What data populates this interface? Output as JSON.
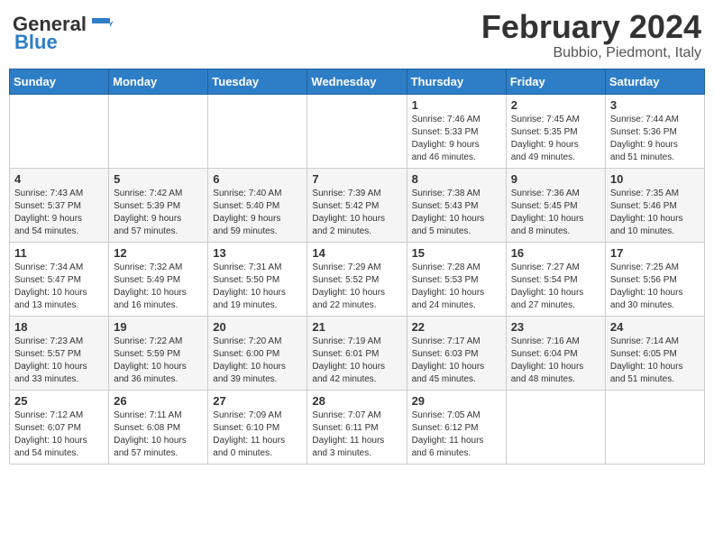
{
  "logo": {
    "general": "General",
    "blue": "Blue"
  },
  "title": "February 2024",
  "location": "Bubbio, Piedmont, Italy",
  "days_header": [
    "Sunday",
    "Monday",
    "Tuesday",
    "Wednesday",
    "Thursday",
    "Friday",
    "Saturday"
  ],
  "weeks": [
    [
      {
        "day": "",
        "info": ""
      },
      {
        "day": "",
        "info": ""
      },
      {
        "day": "",
        "info": ""
      },
      {
        "day": "",
        "info": ""
      },
      {
        "day": "1",
        "info": "Sunrise: 7:46 AM\nSunset: 5:33 PM\nDaylight: 9 hours\nand 46 minutes."
      },
      {
        "day": "2",
        "info": "Sunrise: 7:45 AM\nSunset: 5:35 PM\nDaylight: 9 hours\nand 49 minutes."
      },
      {
        "day": "3",
        "info": "Sunrise: 7:44 AM\nSunset: 5:36 PM\nDaylight: 9 hours\nand 51 minutes."
      }
    ],
    [
      {
        "day": "4",
        "info": "Sunrise: 7:43 AM\nSunset: 5:37 PM\nDaylight: 9 hours\nand 54 minutes."
      },
      {
        "day": "5",
        "info": "Sunrise: 7:42 AM\nSunset: 5:39 PM\nDaylight: 9 hours\nand 57 minutes."
      },
      {
        "day": "6",
        "info": "Sunrise: 7:40 AM\nSunset: 5:40 PM\nDaylight: 9 hours\nand 59 minutes."
      },
      {
        "day": "7",
        "info": "Sunrise: 7:39 AM\nSunset: 5:42 PM\nDaylight: 10 hours\nand 2 minutes."
      },
      {
        "day": "8",
        "info": "Sunrise: 7:38 AM\nSunset: 5:43 PM\nDaylight: 10 hours\nand 5 minutes."
      },
      {
        "day": "9",
        "info": "Sunrise: 7:36 AM\nSunset: 5:45 PM\nDaylight: 10 hours\nand 8 minutes."
      },
      {
        "day": "10",
        "info": "Sunrise: 7:35 AM\nSunset: 5:46 PM\nDaylight: 10 hours\nand 10 minutes."
      }
    ],
    [
      {
        "day": "11",
        "info": "Sunrise: 7:34 AM\nSunset: 5:47 PM\nDaylight: 10 hours\nand 13 minutes."
      },
      {
        "day": "12",
        "info": "Sunrise: 7:32 AM\nSunset: 5:49 PM\nDaylight: 10 hours\nand 16 minutes."
      },
      {
        "day": "13",
        "info": "Sunrise: 7:31 AM\nSunset: 5:50 PM\nDaylight: 10 hours\nand 19 minutes."
      },
      {
        "day": "14",
        "info": "Sunrise: 7:29 AM\nSunset: 5:52 PM\nDaylight: 10 hours\nand 22 minutes."
      },
      {
        "day": "15",
        "info": "Sunrise: 7:28 AM\nSunset: 5:53 PM\nDaylight: 10 hours\nand 24 minutes."
      },
      {
        "day": "16",
        "info": "Sunrise: 7:27 AM\nSunset: 5:54 PM\nDaylight: 10 hours\nand 27 minutes."
      },
      {
        "day": "17",
        "info": "Sunrise: 7:25 AM\nSunset: 5:56 PM\nDaylight: 10 hours\nand 30 minutes."
      }
    ],
    [
      {
        "day": "18",
        "info": "Sunrise: 7:23 AM\nSunset: 5:57 PM\nDaylight: 10 hours\nand 33 minutes."
      },
      {
        "day": "19",
        "info": "Sunrise: 7:22 AM\nSunset: 5:59 PM\nDaylight: 10 hours\nand 36 minutes."
      },
      {
        "day": "20",
        "info": "Sunrise: 7:20 AM\nSunset: 6:00 PM\nDaylight: 10 hours\nand 39 minutes."
      },
      {
        "day": "21",
        "info": "Sunrise: 7:19 AM\nSunset: 6:01 PM\nDaylight: 10 hours\nand 42 minutes."
      },
      {
        "day": "22",
        "info": "Sunrise: 7:17 AM\nSunset: 6:03 PM\nDaylight: 10 hours\nand 45 minutes."
      },
      {
        "day": "23",
        "info": "Sunrise: 7:16 AM\nSunset: 6:04 PM\nDaylight: 10 hours\nand 48 minutes."
      },
      {
        "day": "24",
        "info": "Sunrise: 7:14 AM\nSunset: 6:05 PM\nDaylight: 10 hours\nand 51 minutes."
      }
    ],
    [
      {
        "day": "25",
        "info": "Sunrise: 7:12 AM\nSunset: 6:07 PM\nDaylight: 10 hours\nand 54 minutes."
      },
      {
        "day": "26",
        "info": "Sunrise: 7:11 AM\nSunset: 6:08 PM\nDaylight: 10 hours\nand 57 minutes."
      },
      {
        "day": "27",
        "info": "Sunrise: 7:09 AM\nSunset: 6:10 PM\nDaylight: 11 hours\nand 0 minutes."
      },
      {
        "day": "28",
        "info": "Sunrise: 7:07 AM\nSunset: 6:11 PM\nDaylight: 11 hours\nand 3 minutes."
      },
      {
        "day": "29",
        "info": "Sunrise: 7:05 AM\nSunset: 6:12 PM\nDaylight: 11 hours\nand 6 minutes."
      },
      {
        "day": "",
        "info": ""
      },
      {
        "day": "",
        "info": ""
      }
    ]
  ]
}
